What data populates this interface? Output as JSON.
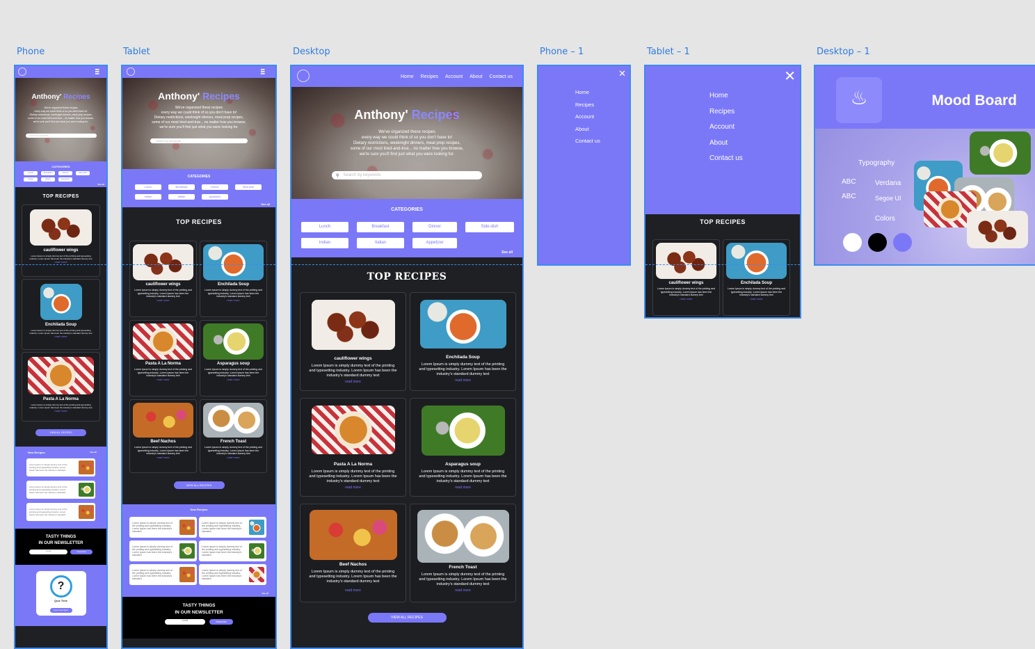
{
  "labels": {
    "phone": "Phone",
    "tablet": "Tablet",
    "desktop": "Desktop",
    "phone1": "Phone – 1",
    "tablet1": "Tablet – 1",
    "desktop1": "Desktop – 1"
  },
  "brand": {
    "name": "Anthony'",
    "accent": "Recipes",
    "accent_color": "#7b78f8",
    "dark_color": "#1f2024"
  },
  "nav": [
    "Home",
    "Recipes",
    "Account",
    "About",
    "Contact us"
  ],
  "hero": {
    "l1": "We've organized these recipes",
    "l2": "every way we could think of so you don't have to!",
    "l3": "Dietary restrictions, weeknight dinners, meal prep recipes,",
    "l4": "some of our most tried-and-true... no matter how you browse,",
    "l5": "we're sure you'll find just what you were looking for.",
    "search_placeholder": "Search by keywords"
  },
  "categories": {
    "title": "CATEGORIES",
    "items": [
      "Lunch",
      "Breakfast",
      "Dinner",
      "Side-dish",
      "Indian",
      "Italian",
      "Appetizer"
    ],
    "see_all": "See all"
  },
  "top": {
    "title": "TOP RECIPES",
    "recipes": [
      {
        "name": "cauliflower wings",
        "img": "f-wings"
      },
      {
        "name": "Enchilada Soup",
        "img": "f-soup"
      },
      {
        "name": "Pasta A La Norma",
        "img": "f-pasta"
      },
      {
        "name": "Asparagus soup",
        "img": "f-aspar"
      },
      {
        "name": "Beef Nachos",
        "img": "f-nachos"
      },
      {
        "name": "French Toast",
        "img": "f-toast"
      }
    ],
    "desc": "Lorem Ipsum is simply dummy text of the printing and typesetting industry. Lorem Ipsum has been the industry's standard dummy text",
    "read_more": "read more",
    "view_all": "VIEW ALL RECIPES"
  },
  "newrecipes": {
    "title": "New Recipes",
    "see_all": "See all",
    "text": "Lorem Ipsum is simply dummy text of the printing and typesetting industry. Lorem Ipsum has been the industry's standard"
  },
  "newsletter": {
    "l1": "TASTY THINGS",
    "l2": "IN OUR NEWSLETTER",
    "email": "email",
    "subscribe": "Subscribe"
  },
  "quiz": {
    "title": "Quiz Time",
    "button": "Free Food Quiz"
  },
  "mood": {
    "title": "Mood Board",
    "typography": "Typography",
    "abc1": "ABC",
    "abc2": "ABC",
    "font1": "Verdana",
    "font2": "Segoe UI",
    "colors": "Colors",
    "swatches": [
      "#ffffff",
      "#000000",
      "#7b78f8"
    ]
  }
}
